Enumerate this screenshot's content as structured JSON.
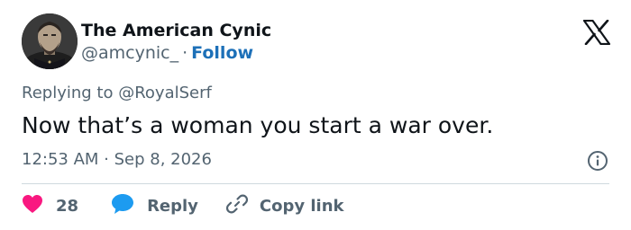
{
  "author": {
    "name": "The American Cynic",
    "handle": "@amcynic_",
    "separator": "·",
    "follow_label": "Follow"
  },
  "reply_context": {
    "prefix": "Replying to",
    "mention": "@RoyalSerf"
  },
  "tweet": {
    "text": "Now that’s a woman you start a war over.",
    "timestamp": "12:53 AM · Sep 8, 2026"
  },
  "actions": {
    "like_count": "28",
    "reply_label": "Reply",
    "copy_link_label": "Copy link"
  },
  "icons": {
    "brand": "x-logo-icon",
    "info": "info-icon",
    "like": "heart-icon",
    "reply": "speech-bubble-icon",
    "copy": "link-icon"
  },
  "colors": {
    "link": "#1d70b8",
    "muted": "#536471",
    "like": "#f91880",
    "reply": "#1d9bf0",
    "divider": "#cfd9de"
  }
}
